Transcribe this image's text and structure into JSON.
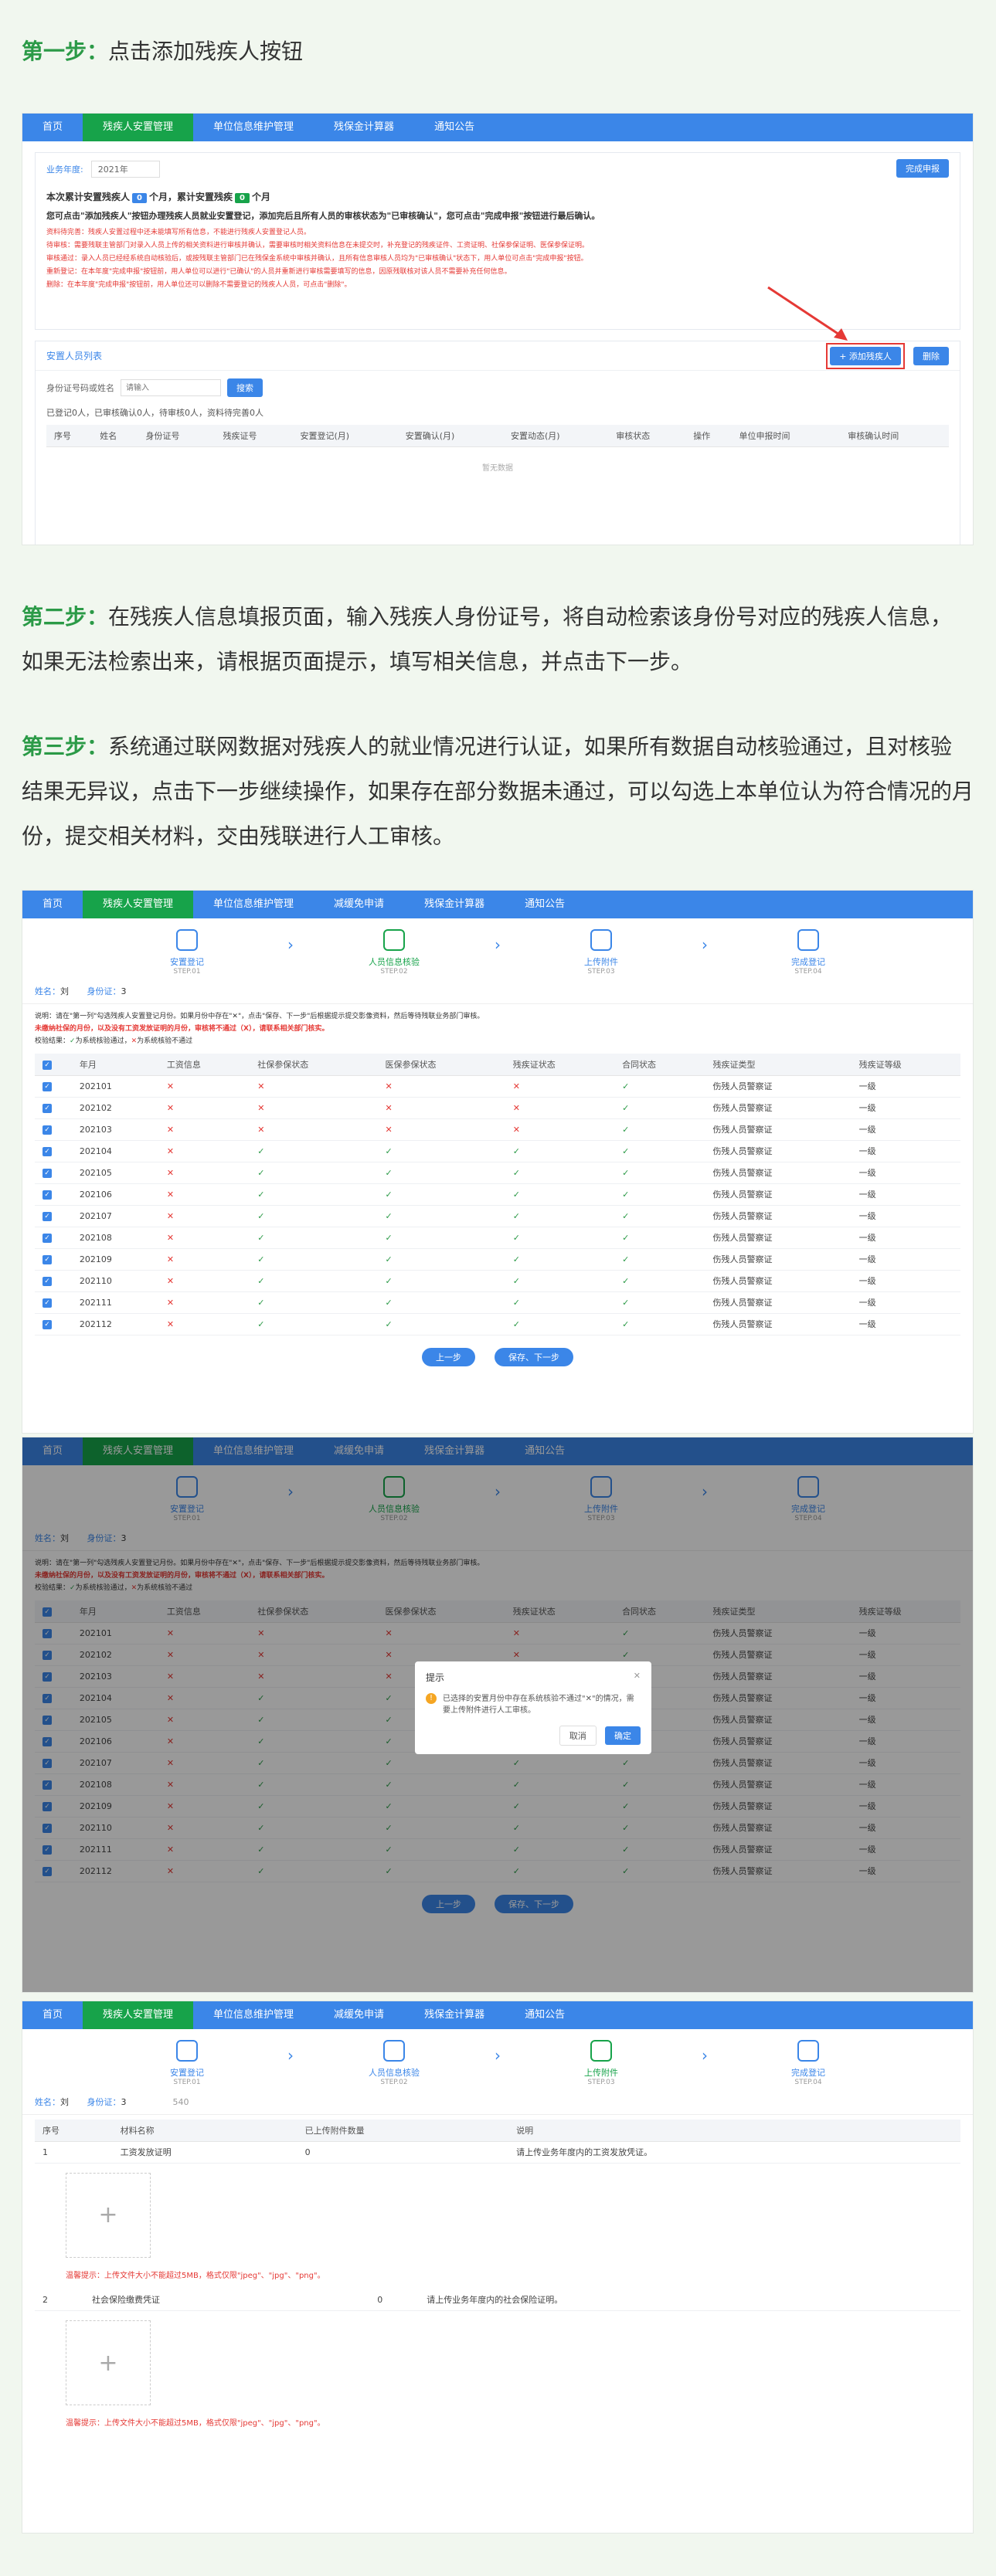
{
  "step1": {
    "label": "第一步：",
    "text": "点击添加残疾人按钮"
  },
  "step2": {
    "label": "第二步：",
    "text": "在残疾人信息填报页面，输入残疾人身份证号，将自动检索该身份号对应的残疾人信息，如果无法检索出来，请根据页面提示，填写相关信息，并点击下一步。"
  },
  "step3": {
    "label": "第三步：",
    "text": "系统通过联网数据对残疾人的就业情况进行认证，如果所有数据自动核验通过，且对核验结果无异议，点击下一步继续操作，如果存在部分数据未通过，可以勾选上本单位认为符合情况的月份，提交相关材料，交由残联进行人工审核。"
  },
  "nav1": [
    "首页",
    "残疾人安置管理",
    "单位信息维护管理",
    "残保金计算器",
    "通知公告"
  ],
  "nav2": [
    "首页",
    "残疾人安置管理",
    "单位信息维护管理",
    "减缓免申请",
    "残保金计算器",
    "通知公告"
  ],
  "s1": {
    "year_label": "业务年度:",
    "year_value": "2021年",
    "apply_btn": "完成申报",
    "summary_pre": "本次累计安置残疾人",
    "count1": "0",
    "summary_mid": "个月，累计安置残疾",
    "count2": "0",
    "summary_post": "个月",
    "instruction": "您可点击\"添加残疾人\"按钮办理残疾人员就业安置登记，添加完后且所有人员的审核状态为\"已审核确认\"，您可点击\"完成申报\"按钮进行最后确认。",
    "notes": [
      "资料待完善：残疾人安置过程中还未能填写所有信息，不能进行残疾人安置登记人员。",
      "待审核：需要残联主管部门对录入人员上传的相关资料进行审核并确认，需要审核时相关资料信息在未提交时，补充登记的残疾证件、工资证明、社保参保证明、医保参保证明。",
      "审核通过：录入人员已经经系统自动核验后，或按残联主管部门已在残保金系统中审核并确认，且所有信息审核人员均为\"已审核确认\"状态下，用人单位可点击\"完成申报\"按钮。",
      "重新登记：在本年度\"完成申报\"按钮前，用人单位可以进行\"已确认\"的人员并重新进行审核需要填写的信息，因原残联核对该人员不需要补充任何信息。",
      "删除：在本年度\"完成申报\"按钮前，用人单位还可以删除不需要登记的残疾人人员，可点击\"删除\"。"
    ],
    "list_title": "安置人员列表",
    "add_btn": "+ 添加残疾人",
    "del_btn": "删除",
    "search_label": "身份证号码或姓名",
    "search_placeholder": "请输入",
    "search_btn": "搜索",
    "stats": "已登记0人，已审核确认0人，待审核0人，资料待完善0人",
    "columns": [
      "序号",
      "姓名",
      "身份证号",
      "残疾证号",
      "安置登记(月)",
      "安置确认(月)",
      "安置动态(月)",
      "审核状态",
      "操作",
      "单位申报时间",
      "审核确认时间"
    ],
    "empty": "暂无数据"
  },
  "steps": [
    {
      "label": "安置登记",
      "sub": "STEP.01"
    },
    {
      "label": "人员信息核验",
      "sub": "STEP.02"
    },
    {
      "label": "上传附件",
      "sub": "STEP.03"
    },
    {
      "label": "完成登记",
      "sub": "STEP.04"
    }
  ],
  "person": {
    "name_label": "姓名：",
    "name": "刘",
    "id_label": "身份证：",
    "id": "3",
    "id2": "3",
    "id3": "3",
    "id3_suffix": "540"
  },
  "verify": {
    "explain": "说明：请在\"第一列\"勾选残疾人安置登记月份。如果月份中存在\"✕\"，点击\"保存、下一步\"后根据提示提交影像资料，然后等待残联业务部门审核。",
    "warn": "未缴纳社保的月份，以及没有工资发放证明的月份，审核将不通过（X），请联系相关部门核实。",
    "legend_pre": "校验结果：",
    "legend_ok": "为系统核验通过，",
    "legend_x": "为系统核验不通过",
    "columns": [
      "年月",
      "工资信息",
      "社保参保状态",
      "医保参保状态",
      "残疾证状态",
      "合同状态",
      "残疾证类型",
      "残疾证等级"
    ],
    "rows": [
      {
        "ym": "202101",
        "w": "x",
        "s": "x",
        "m": "x",
        "d": "x",
        "c": "ok",
        "type": "伤残人员警察证",
        "level": "一级"
      },
      {
        "ym": "202102",
        "w": "x",
        "s": "x",
        "m": "x",
        "d": "x",
        "c": "ok",
        "type": "伤残人员警察证",
        "level": "一级"
      },
      {
        "ym": "202103",
        "w": "x",
        "s": "x",
        "m": "x",
        "d": "x",
        "c": "ok",
        "type": "伤残人员警察证",
        "level": "一级"
      },
      {
        "ym": "202104",
        "w": "x",
        "s": "ok",
        "m": "ok",
        "d": "ok",
        "c": "ok",
        "type": "伤残人员警察证",
        "level": "一级"
      },
      {
        "ym": "202105",
        "w": "x",
        "s": "ok",
        "m": "ok",
        "d": "ok",
        "c": "ok",
        "type": "伤残人员警察证",
        "level": "一级"
      },
      {
        "ym": "202106",
        "w": "x",
        "s": "ok",
        "m": "ok",
        "d": "ok",
        "c": "ok",
        "type": "伤残人员警察证",
        "level": "一级"
      },
      {
        "ym": "202107",
        "w": "x",
        "s": "ok",
        "m": "ok",
        "d": "ok",
        "c": "ok",
        "type": "伤残人员警察证",
        "level": "一级"
      },
      {
        "ym": "202108",
        "w": "x",
        "s": "ok",
        "m": "ok",
        "d": "ok",
        "c": "ok",
        "type": "伤残人员警察证",
        "level": "一级"
      },
      {
        "ym": "202109",
        "w": "x",
        "s": "ok",
        "m": "ok",
        "d": "ok",
        "c": "ok",
        "type": "伤残人员警察证",
        "level": "一级"
      },
      {
        "ym": "202110",
        "w": "x",
        "s": "ok",
        "m": "ok",
        "d": "ok",
        "c": "ok",
        "type": "伤残人员警察证",
        "level": "一级"
      },
      {
        "ym": "202111",
        "w": "x",
        "s": "ok",
        "m": "ok",
        "d": "ok",
        "c": "ok",
        "type": "伤残人员警察证",
        "level": "一级"
      },
      {
        "ym": "202112",
        "w": "x",
        "s": "ok",
        "m": "ok",
        "d": "ok",
        "c": "ok",
        "type": "伤残人员警察证",
        "level": "一级"
      }
    ],
    "prev_btn": "上一步",
    "next_btn": "保存、下一步"
  },
  "modal": {
    "title": "提示",
    "message": "已选择的安置月份中存在系统核验不通过\"✕\"的情况，需要上传附件进行人工审核。",
    "cancel": "取消",
    "confirm": "确定"
  },
  "upload": {
    "columns": [
      "序号",
      "材料名称",
      "已上传附件数量",
      "说明"
    ],
    "items": [
      {
        "no": "1",
        "name": "工资发放证明",
        "count": "0",
        "desc": "请上传业务年度内的工资发放凭证。"
      },
      {
        "no": "2",
        "name": "社会保险缴费凭证",
        "count": "0",
        "desc": "请上传业务年度内的社会保险证明。"
      }
    ],
    "tip": "温馨提示：上传文件大小不能超过5MB，格式仅限\"jpeg\"、\"jpg\"、\"png\"。",
    "plus": "+"
  },
  "colors": {
    "primary": "#3b86e8",
    "active": "#17a34a",
    "error": "#e53935",
    "step_green": "#2b9a47"
  }
}
